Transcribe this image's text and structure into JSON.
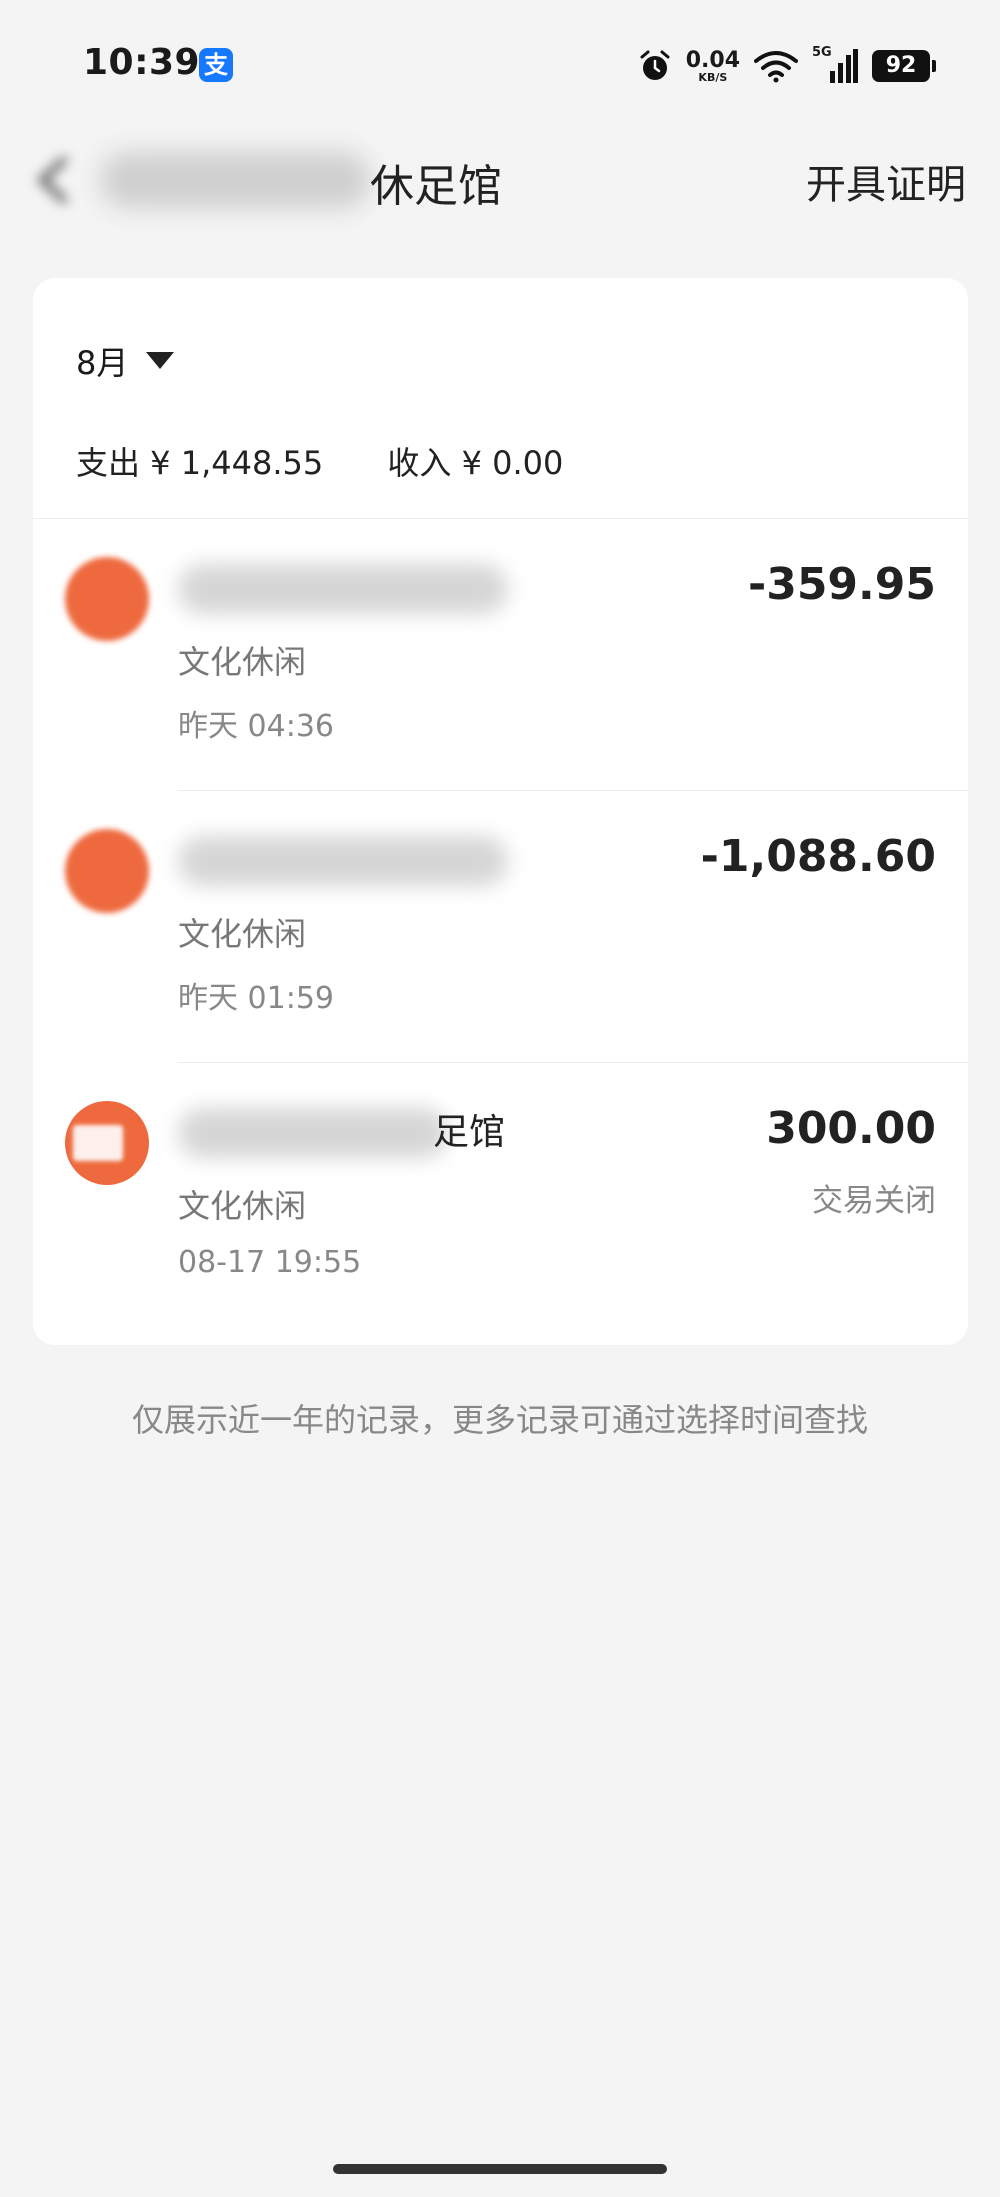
{
  "status_bar": {
    "time": "10:39",
    "app_icon_glyph": "支",
    "net_speed_value": "0.04",
    "net_speed_unit": "KB/S",
    "network_type": "5G",
    "battery": "92",
    "icons": [
      "alarm-icon",
      "wifi-icon",
      "cellular-signal-icon",
      "battery-icon"
    ]
  },
  "header": {
    "merchant_title_visible": "休足馆",
    "cert_link": "开具证明"
  },
  "summary": {
    "month": "8月",
    "expense": "支出 ¥ 1,448.55",
    "income": "收入 ¥ 0.00"
  },
  "transactions": [
    {
      "category": "文化休闲",
      "time": "昨天 04:36",
      "amount": "-359.95"
    },
    {
      "category": "文化休闲",
      "time": "昨天 01:59",
      "amount": "-1,088.60"
    },
    {
      "name_tail": "足馆",
      "category": "文化休闲",
      "time": "08-17 19:55",
      "amount": "300.00",
      "status": "交易关闭"
    }
  ],
  "footer_note": "仅展示近一年的记录，更多记录可通过选择时间查找",
  "colors": {
    "accent_orange": "#ee6a3e",
    "alipay_blue": "#1677ff",
    "background": "#f4f4f4"
  }
}
